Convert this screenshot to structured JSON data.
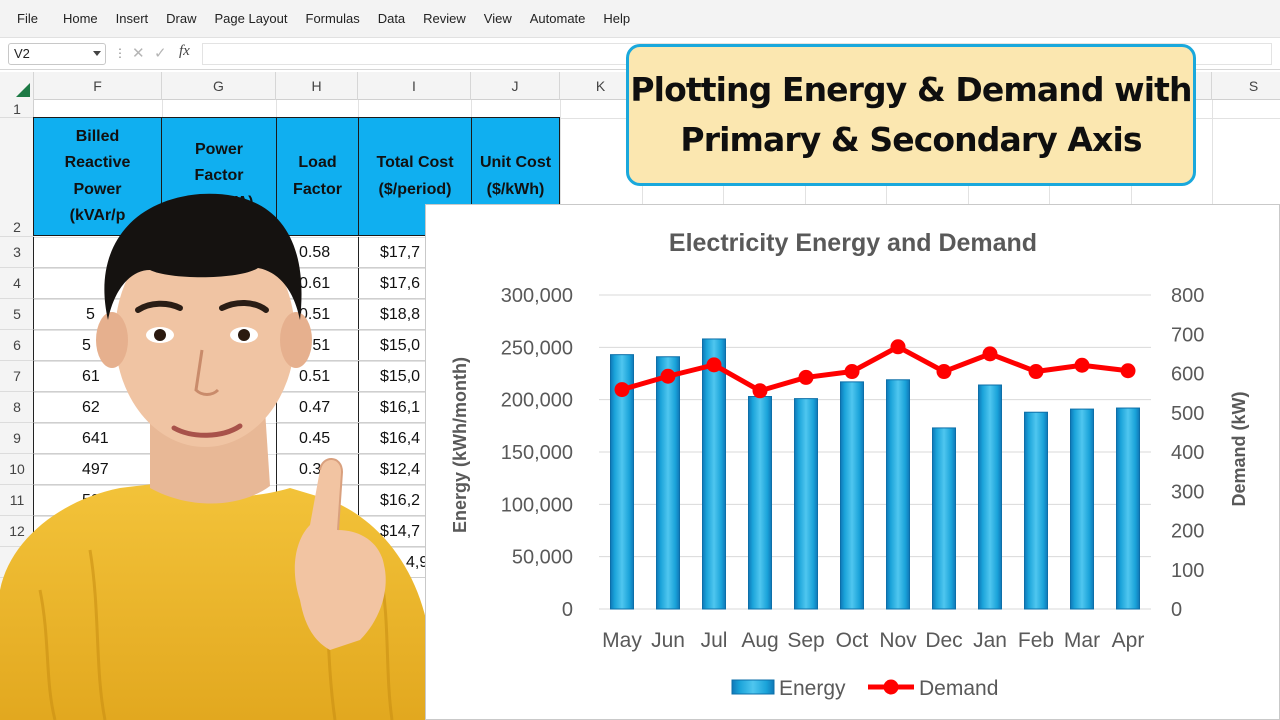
{
  "menu": [
    "File",
    "Home",
    "Insert",
    "Draw",
    "Page Layout",
    "Formulas",
    "Data",
    "Review",
    "View",
    "Automate",
    "Help"
  ],
  "formula_bar": {
    "name_box": "V2",
    "fx": "fx",
    "cancel": "✕",
    "enter": "✓",
    "formula": ""
  },
  "columns": [
    "F",
    "G",
    "H",
    "I",
    "J",
    "K",
    "S"
  ],
  "rows": [
    "1",
    "2",
    "3",
    "4",
    "5",
    "6",
    "7",
    "8",
    "9",
    "10",
    "11",
    "12",
    "1"
  ],
  "table": {
    "headers": {
      "F": "Billed Reactive Power (kVAr/p",
      "G": "Power Factor (kW/kVA)",
      "H": "Load Factor",
      "I": "Total Cost ($/period)",
      "J": "Unit Cost ($/kWh)"
    },
    "rows": [
      {
        "F": "",
        "H": "0.58",
        "I": "$17,7"
      },
      {
        "F": "",
        "H": "0.61",
        "I": "$17,6"
      },
      {
        "F": "5",
        "H": "0.51",
        "I": "$18,8"
      },
      {
        "F": "5",
        "H": "0.51",
        "I": "$15,0"
      },
      {
        "F": "61",
        "H": "0.51",
        "I": "$15,0"
      },
      {
        "F": "62",
        "H": "0.47",
        "I": "$16,1"
      },
      {
        "F": "641",
        "H": "0.45",
        "I": "$16,4"
      },
      {
        "F": "497",
        "H": "0.3",
        "I": "$12,4"
      },
      {
        "F": "590",
        "H": "0",
        "I": "$16,2"
      },
      {
        "F": "",
        "H": "",
        "I": "$14,7"
      },
      {
        "F": "",
        "H": "",
        "I": "4,9"
      }
    ]
  },
  "title_box": {
    "line1": "Plotting Energy & Demand with",
    "line2": "Primary & Secondary Axis"
  },
  "colors": {
    "energy_bar": "#1aa3d9",
    "demand_line": "#ff0000",
    "table_header": "#10aff0",
    "title_border": "#1aa8dc",
    "title_bg": "#fbe7b0"
  },
  "chart_data": {
    "type": "bar",
    "title": "Electricity Energy and Demand",
    "categories": [
      "May",
      "Jun",
      "Jul",
      "Aug",
      "Sep",
      "Oct",
      "Nov",
      "Dec",
      "Jan",
      "Feb",
      "Mar",
      "Apr"
    ],
    "series": [
      {
        "name": "Energy",
        "type": "bar",
        "axis": "primary",
        "values": [
          243000,
          241000,
          258000,
          203000,
          201000,
          217000,
          219000,
          173000,
          214000,
          188000,
          191000,
          192000
        ]
      },
      {
        "name": "Demand",
        "type": "line",
        "axis": "secondary",
        "values": [
          559,
          593,
          622,
          556,
          590,
          605,
          668,
          605,
          650,
          605,
          621,
          607
        ]
      }
    ],
    "ylabel": "Energy  (kWh/month)",
    "ylim": [
      0,
      300000
    ],
    "yticks": [
      "0",
      "50,000",
      "100,000",
      "150,000",
      "200,000",
      "250,000",
      "300,000"
    ],
    "ytick_values": [
      0,
      50000,
      100000,
      150000,
      200000,
      250000,
      300000
    ],
    "y2label": "Demand (kW)",
    "y2lim": [
      0,
      800
    ],
    "y2ticks": [
      "0",
      "100",
      "200",
      "300",
      "400",
      "500",
      "600",
      "700",
      "800"
    ],
    "y2tick_values": [
      0,
      100,
      200,
      300,
      400,
      500,
      600,
      700,
      800
    ],
    "grid": true,
    "legend": "bottom"
  }
}
